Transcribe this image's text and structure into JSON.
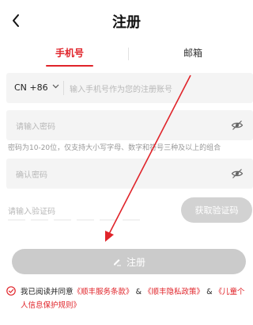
{
  "header": {
    "back_icon": "chevron-left-icon",
    "title": "注册"
  },
  "tabs": [
    {
      "label": "手机号",
      "active": true
    },
    {
      "label": "邮箱",
      "active": false
    }
  ],
  "phone": {
    "country_code": "CN +86",
    "placeholder": "输入手机号作为您的注册账号"
  },
  "password": {
    "placeholder": "请输入密码",
    "hint": "密码为10-20位，仅支持大小写字母、数字和符号三种及以上的组合"
  },
  "confirm": {
    "placeholder": "确认密码"
  },
  "verification": {
    "placeholder": "请输入验证码",
    "button_label": "获取验证码"
  },
  "submit": {
    "label": "注册",
    "icon": "pencil-icon"
  },
  "agreement": {
    "prefix": "我已阅读并同意",
    "link1": "《顺丰服务条款》",
    "sep1": "&",
    "link2": "《顺丰隐私政策》",
    "sep2": "&",
    "link3": "《儿童个人信息保护规则》"
  },
  "colors": {
    "accent": "#e0242a",
    "disabled_button": "#cbcbcb",
    "field_bg": "#f4f4f4"
  }
}
